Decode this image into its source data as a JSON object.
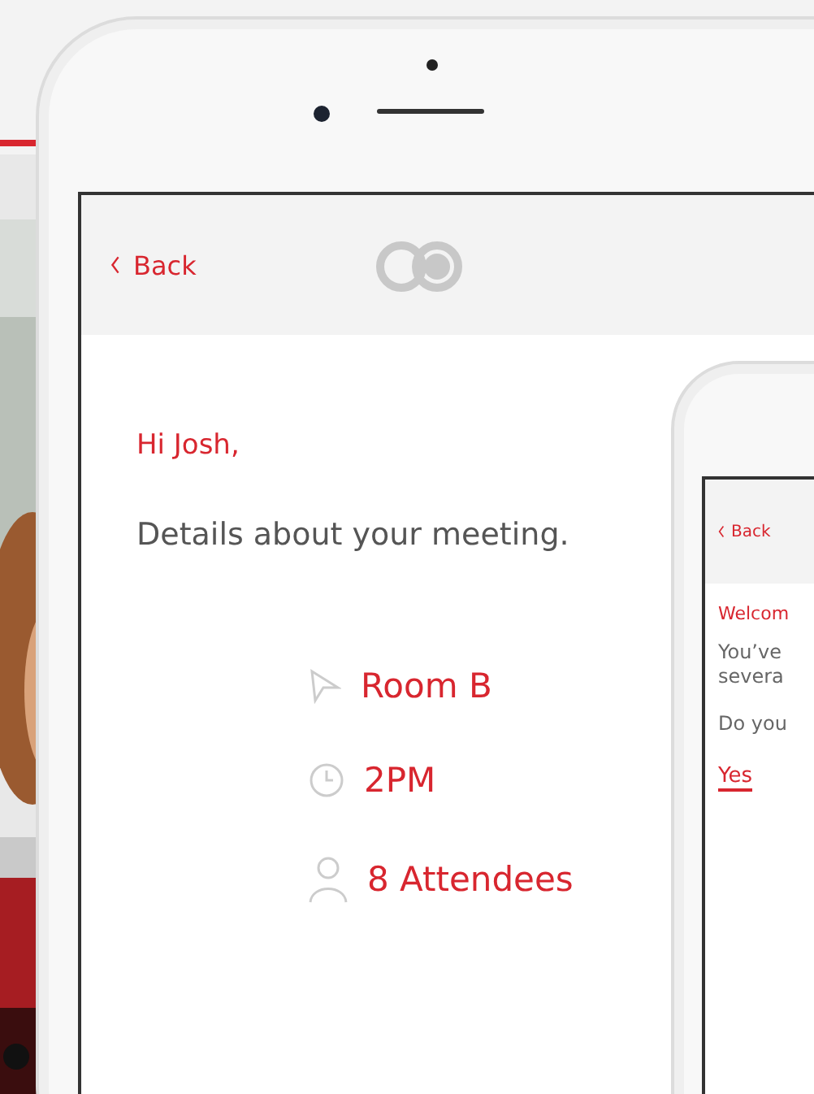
{
  "main_screen": {
    "back": "Back",
    "greeting": "Hi Josh,",
    "heading": "Details about your meeting.",
    "details": [
      {
        "kind": "location",
        "text": "Room B"
      },
      {
        "kind": "time",
        "text": "2PM"
      },
      {
        "kind": "attendees",
        "text": "8 Attendees"
      }
    ]
  },
  "second_screen": {
    "back": "Back",
    "welcome": "Welcom",
    "lines": [
      "You’ve",
      "severa"
    ],
    "question": "Do you",
    "answer": "Yes"
  }
}
